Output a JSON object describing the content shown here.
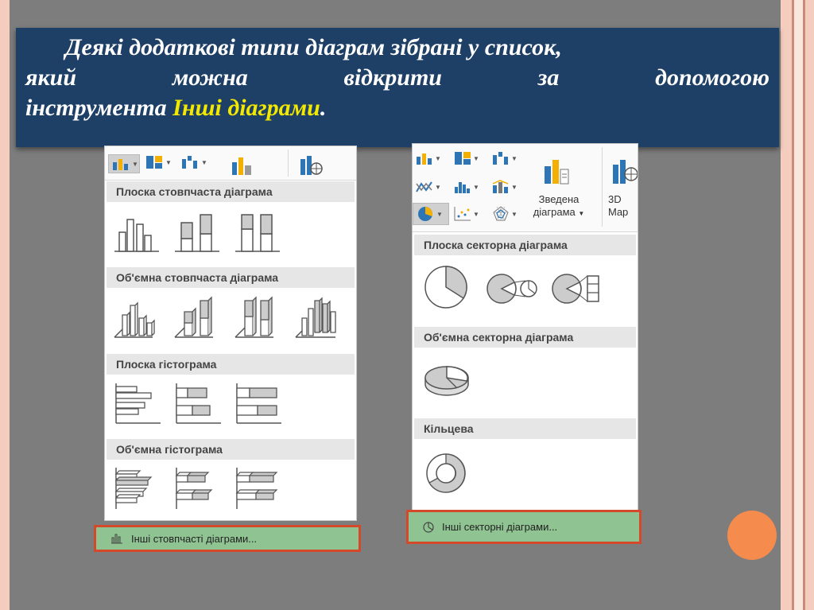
{
  "title": {
    "line1": "Деякі додаткові типи діаграм зібрані у список,",
    "line2_words": [
      "який",
      "можна",
      "відкрити",
      "за",
      "допомогою"
    ],
    "line3_prefix": "інструмента ",
    "line3_highlight": "Інші діаграми",
    "line3_suffix": "."
  },
  "left_panel": {
    "sections": [
      "Плоска стовпчаста діаграма",
      "Об'ємна стовпчаста діаграма",
      "Плоска гістограма",
      "Об'ємна гістограма"
    ],
    "footer_label": "Інші стовпчасті діаграми..."
  },
  "right_panel": {
    "toolbar": {
      "pivot_line1": "Зведена",
      "pivot_line2": "діаграма",
      "map_line1": "3D",
      "map_line2": "Map"
    },
    "sections": [
      "Плоска секторна діаграма",
      "Об'ємна секторна діаграма",
      "Кільцева"
    ],
    "footer_label": "Інші секторні діаграми..."
  },
  "colors": {
    "slide_bg": "#7d7d7d",
    "title_bg": "#1e3f66",
    "highlight": "#f2e800",
    "footer_bg": "#8fc391",
    "footer_border": "#d5492b",
    "accent_circle": "#f58b4c"
  }
}
